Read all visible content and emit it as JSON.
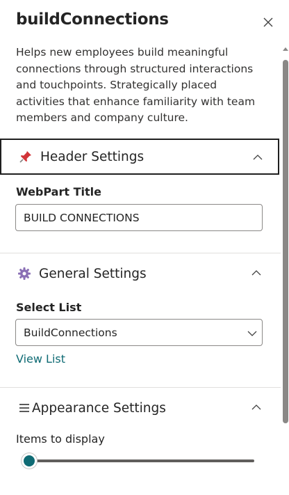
{
  "panel": {
    "title": "buildConnections",
    "close_icon": "close-icon",
    "description": "Helps new employees build meaningful connections through structured interactions and touchpoints. Strategically placed activities that enhance familiarity with team members and company culture."
  },
  "sections": {
    "header": {
      "icon": "pushpin-icon",
      "label": "Header Settings",
      "expanded": true,
      "webpart_title_label": "WebPart Title",
      "webpart_title_value": "BUILD CONNECTIONS"
    },
    "general": {
      "icon": "gear-icon",
      "label": "General Settings",
      "expanded": true,
      "select_list_label": "Select List",
      "select_list_value": "BuildConnections",
      "view_list_link": "View List"
    },
    "appearance": {
      "icon": "hamburger-icon",
      "label": "Appearance Settings",
      "expanded": true,
      "items_label": "Items to display",
      "items_slider_fraction": 0.0
    }
  },
  "colors": {
    "accent": "#0f6b74",
    "text": "#242424",
    "pin": "#d13438"
  }
}
